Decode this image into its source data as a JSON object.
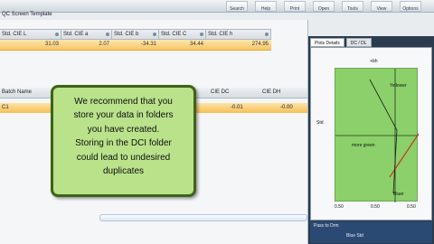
{
  "app": {
    "title": "QC Screen Template"
  },
  "ribbon": {
    "buttons": [
      "Search",
      "Help",
      "Print",
      "Open",
      "Tools",
      "View",
      "Options"
    ]
  },
  "top_grid": {
    "headers": [
      "Std. CIE L",
      "Std. CIE a",
      "Std. CIE b",
      "Std. CIE C",
      "Std. CIE h"
    ],
    "values": [
      "31.03",
      "2.07",
      "-34.31",
      "34.44",
      "274.95"
    ]
  },
  "batch_grid": {
    "headers": [
      "Batch Name",
      "CIE DC",
      "CIE DH"
    ],
    "row": {
      "name": "C1",
      "dc": "-0.01",
      "dh": "-0.00"
    }
  },
  "diagram": {
    "tabs": [
      "Plots Details",
      "DC / DL"
    ],
    "labels": {
      "top": "+bh",
      "right_arrow": "Yellower",
      "left_label": "more green",
      "bottom_right": "Bluer",
      "axis_left": "Std",
      "tick_left": "0.50",
      "tick_mid": "0.50",
      "tick_right": "0.50"
    },
    "status": [
      "Pass to Drm",
      "Blue Std"
    ]
  },
  "callout": {
    "lines": [
      "We recommend that you",
      "store your data in folders",
      "you have created.",
      "Storing in the DCI folder",
      "could lead to undesired",
      "duplicates"
    ]
  }
}
